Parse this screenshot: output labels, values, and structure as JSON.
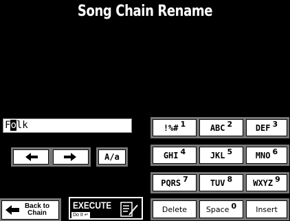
{
  "header": {
    "title": "Song Chain Rename"
  },
  "name_field": {
    "before_cursor": "F",
    "cursor_char": "o",
    "after_cursor": "lk"
  },
  "keys": {
    "k1": {
      "label": "!%#",
      "num": "1"
    },
    "k2": {
      "label": "ABC",
      "num": "2"
    },
    "k3": {
      "label": "DEF",
      "num": "3"
    },
    "k4": {
      "label": "GHI",
      "num": "4"
    },
    "k5": {
      "label": "JKL",
      "num": "5"
    },
    "k6": {
      "label": "MNO",
      "num": "6"
    },
    "k7": {
      "label": "PQRS",
      "num": "7"
    },
    "k8": {
      "label": "TUV",
      "num": "8"
    },
    "k9": {
      "label": "WXYZ",
      "num": "9"
    },
    "delete": {
      "label": "Delete"
    },
    "space": {
      "label": "Space",
      "num": "0"
    },
    "insert": {
      "label": "Insert"
    }
  },
  "controls": {
    "case_toggle": "A/a",
    "back_line1": "Back to",
    "back_line2": "Chain",
    "execute": "EXECUTE",
    "do_it": "Do It"
  },
  "icons": {
    "cursor_left": "arrow-left-icon",
    "cursor_right": "arrow-right-icon",
    "back": "arrow-left-icon",
    "execute": "document-edit-icon",
    "enter": "enter-icon"
  }
}
